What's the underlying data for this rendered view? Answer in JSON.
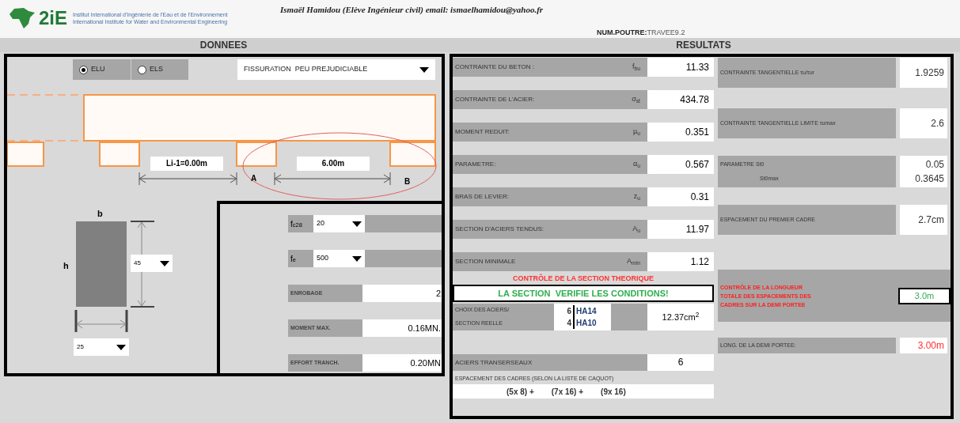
{
  "header": {
    "logo": "2iE",
    "logo_subtitle": [
      "Institut International d'Ingénierie de l'Eau et de l'Environnement",
      "International Institute for Water and Environmental Engineering"
    ],
    "author": "Ismaël Hamidou (Elève Ingénieur civil) email: ismaelhamidou@yahoo.fr",
    "beam_label": "NUM.POUTRE:",
    "beam_id": "TRAVEE9.2"
  },
  "sections": [
    "DONNEES",
    "RESULTATS"
  ],
  "limit_states": [
    {
      "label": "ELU",
      "selected": true
    },
    {
      "label": "ELS",
      "selected": false
    }
  ],
  "cracking": {
    "value": "FISSURATION  PEU PREJUDICIABLE"
  },
  "span_diagram": {
    "previous_span": "Li-1=0.00m",
    "span": "6.00m",
    "support_a": "A",
    "support_b": "B"
  },
  "cross_section": {
    "b_label": "b",
    "h_label": "h",
    "h_value": "45",
    "b_value": "25"
  },
  "inputs": [
    {
      "kind": "select",
      "label": "f$_{c28}$",
      "value": "20"
    },
    {
      "kind": "select",
      "label": "f$_{e}$",
      "value": "500"
    },
    {
      "kind": "field",
      "label": "ENROBAGE",
      "value": "2"
    },
    {
      "kind": "field",
      "label": "MOMENT MAX.",
      "value": "0.16MN."
    },
    {
      "kind": "field",
      "label": "EFFORT TRANCH.",
      "value": "0.20MN"
    }
  ],
  "results": {
    "rows": [
      {
        "label": "CONTRAINTE DU BETON :",
        "symbol": "f$_{bu}$",
        "value": "11.33"
      },
      {
        "label": "CONTRAINTE DE L'ACIER:",
        "symbol": "σ$_{st}$",
        "value": "434.78"
      },
      {
        "label": "MOMENT REDUIT:",
        "symbol": "µ$_{u}$",
        "value": "0.351"
      },
      {
        "label": "PARAMETRE:",
        "symbol": "α$_{u}$",
        "value": "0.567"
      },
      {
        "label": "BRAS DE LEVIER:",
        "symbol": "z$_{u}$",
        "value": "0.31"
      },
      {
        "label": "SECTION D'ACIERS TENDUS:",
        "symbol": "A$_{u}$",
        "value": "11.97"
      },
      {
        "label": "SECTION MINIMALE",
        "symbol": "A$_{min}$",
        "value": "1.12"
      }
    ],
    "check_title": "CONTRÔLE DE LA SECTION THEORIQUE",
    "check_status": "LA SECTION  VERIFIE LES CONDITIONS!",
    "choice": {
      "label": [
        "CHOIX DES ACIERS/",
        "SECTION REELLE"
      ],
      "bars": [
        {
          "count": "6",
          "type": "HA14"
        },
        {
          "count": "4",
          "type": "HA10"
        }
      ],
      "area": "12.37cm$^{2}$"
    },
    "stirrups": {
      "label": "ACIERS TRANSERSEAUX",
      "value": "6"
    },
    "spacing": {
      "label": "ESPACEMENT DES CADRES (SELON LA LISTE DE CAQUOT)",
      "terms": [
        "(5x 8) +",
        "(7x 16) +",
        "(9x 16)"
      ]
    },
    "side": [
      {
        "kind": "pair",
        "label": "CONTRAINTE TANGENTIELLE τu/τur",
        "values": [
          "1.9259"
        ]
      },
      {
        "kind": "pair",
        "label": "CONTRAINTE TANGENTIELLE LIMITE τumax",
        "values": [
          "2.6"
        ]
      },
      {
        "kind": "double",
        "label": "PARAMETRE St0",
        "sublabel": "St0max",
        "values": [
          "0.05",
          "0.3645"
        ]
      },
      {
        "kind": "pair",
        "label": "ESPACEMENT DU PREMIER CADRE",
        "values": [
          "2.7cm"
        ]
      },
      {
        "kind": "control",
        "label": "CONTRÔLE DE LA LONGUEUR TOTALE DES ESPACEMENTS DES CADRES SUR LA DEMI PORTEE",
        "values": [
          "3.0m"
        ]
      },
      {
        "kind": "length",
        "label": "LONG. DE LA DEMI PORTEE:",
        "values": [
          "3.00m"
        ]
      }
    ]
  }
}
